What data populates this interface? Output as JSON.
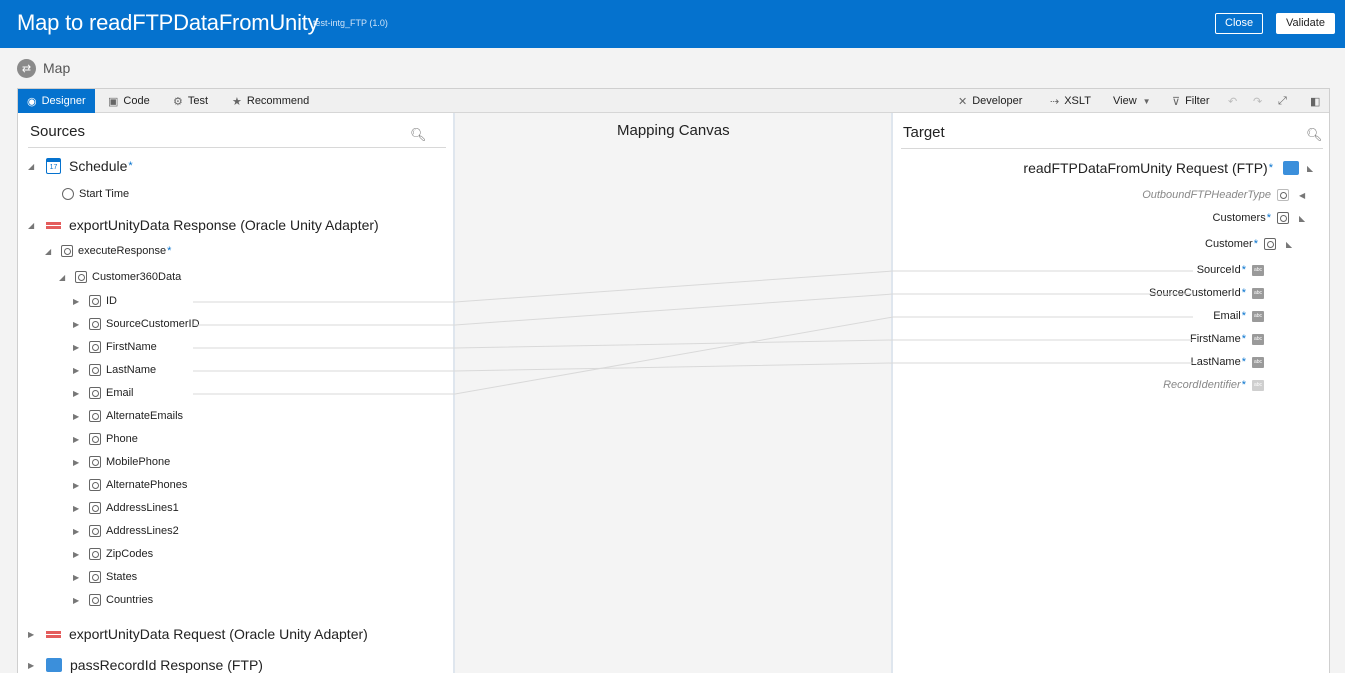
{
  "header": {
    "title": "Map to readFTPDataFromUnity",
    "subtitle": "test-intg_FTP (1.0)",
    "close_label": "Close",
    "validate_label": "Validate"
  },
  "breadcrumb": {
    "label": "Map"
  },
  "toolbar": {
    "designer": "Designer",
    "code": "Code",
    "test": "Test",
    "recommend": "Recommend",
    "developer": "Developer",
    "xslt": "XSLT",
    "view": "View",
    "filter": "Filter"
  },
  "sources": {
    "title": "Sources",
    "schedule": "Schedule",
    "start_time": "Start Time",
    "export_response": "exportUnityData Response (Oracle Unity Adapter)",
    "execute_response": "executeResponse",
    "customer360": "Customer360Data",
    "fields": [
      "ID",
      "SourceCustomerID",
      "FirstName",
      "LastName",
      "Email",
      "AlternateEmails",
      "Phone",
      "MobilePhone",
      "AlternatePhones",
      "AddressLines1",
      "AddressLines2",
      "ZipCodes",
      "States",
      "Countries"
    ],
    "export_request": "exportUnityData Request (Oracle Unity Adapter)",
    "pass_record": "passRecordId Response (FTP)"
  },
  "canvas": {
    "title": "Mapping Canvas"
  },
  "target": {
    "title": "Target",
    "root": "readFTPDataFromUnity Request (FTP)",
    "header_type": "OutboundFTPHeaderType",
    "customers": "Customers",
    "customer": "Customer",
    "fields": [
      "SourceId",
      "SourceCustomerId",
      "Email",
      "FirstName",
      "LastName"
    ],
    "record_identifier": "RecordIdentifier"
  },
  "colors": {
    "brand": "#0572ce",
    "required_star": "#0572ce"
  }
}
